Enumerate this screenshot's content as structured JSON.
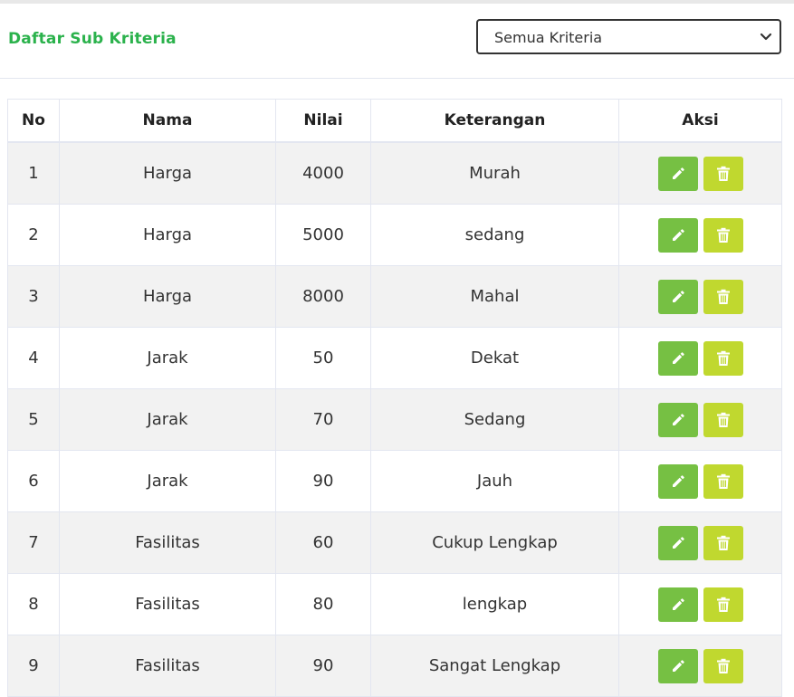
{
  "header": {
    "title": "Daftar Sub Kriteria",
    "filter": {
      "selected": "Semua Kriteria"
    }
  },
  "table": {
    "columns": [
      "No",
      "Nama",
      "Nilai",
      "Keterangan",
      "Aksi"
    ],
    "rows": [
      {
        "no": "1",
        "nama": "Harga",
        "nilai": "4000",
        "keterangan": "Murah"
      },
      {
        "no": "2",
        "nama": "Harga",
        "nilai": "5000",
        "keterangan": "sedang"
      },
      {
        "no": "3",
        "nama": "Harga",
        "nilai": "8000",
        "keterangan": "Mahal"
      },
      {
        "no": "4",
        "nama": "Jarak",
        "nilai": "50",
        "keterangan": "Dekat"
      },
      {
        "no": "5",
        "nama": "Jarak",
        "nilai": "70",
        "keterangan": "Sedang"
      },
      {
        "no": "6",
        "nama": "Jarak",
        "nilai": "90",
        "keterangan": "Jauh"
      },
      {
        "no": "7",
        "nama": "Fasilitas",
        "nilai": "60",
        "keterangan": "Cukup Lengkap"
      },
      {
        "no": "8",
        "nama": "Fasilitas",
        "nilai": "80",
        "keterangan": "lengkap"
      },
      {
        "no": "9",
        "nama": "Fasilitas",
        "nilai": "90",
        "keterangan": "Sangat Lengkap"
      }
    ],
    "actions": {
      "edit_icon": "pencil-icon",
      "delete_icon": "trash-icon"
    }
  },
  "colors": {
    "title": "#2bb24c",
    "edit_button": "#76c043",
    "delete_button": "#c0d82f",
    "stripe": "#f2f2f2"
  }
}
